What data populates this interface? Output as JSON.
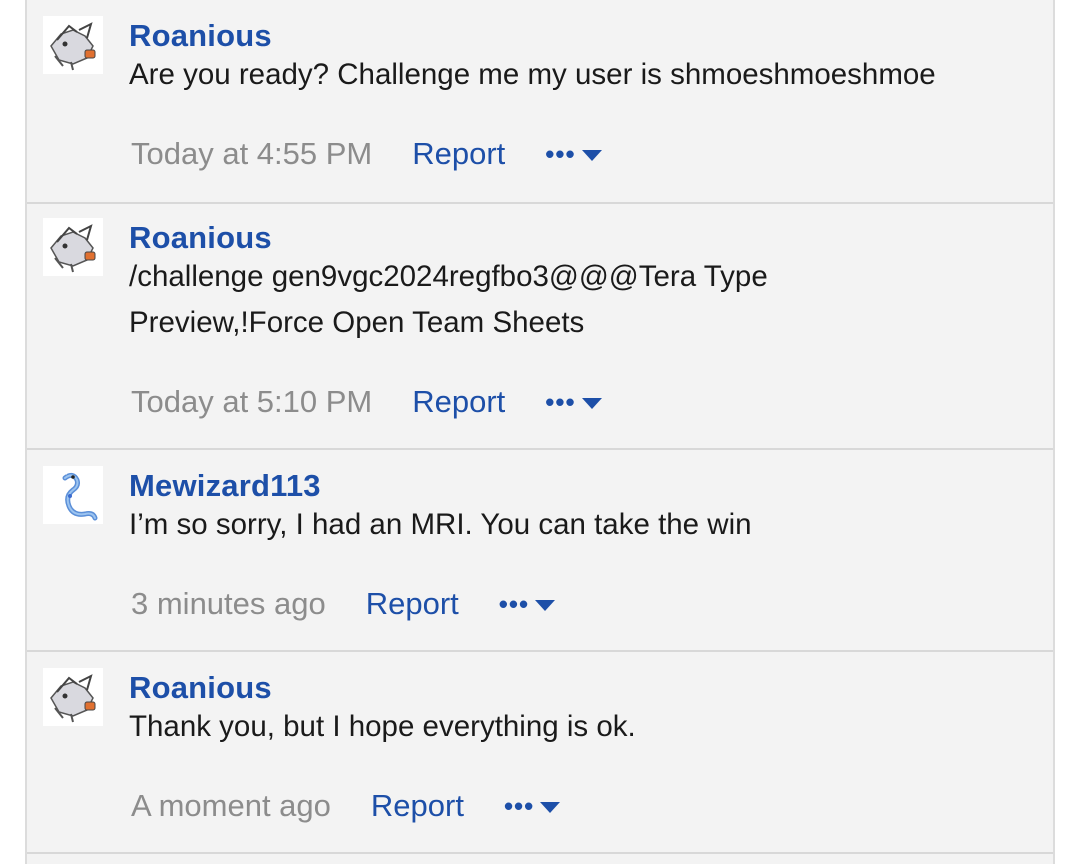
{
  "messages": [
    {
      "author": "Roanious",
      "avatar_icon": "reshiram-sprite-icon",
      "lines": [
        "Are you ready? Challenge me my user is shmoeshmoeshmoe"
      ],
      "time": "Today at 4:55 PM",
      "report_label": "Report",
      "more_label": "•••"
    },
    {
      "author": "Roanious",
      "avatar_icon": "reshiram-sprite-icon",
      "lines": [
        "/challenge gen9vgc2024regfbo3@@@Tera Type",
        "Preview,!Force Open Team Sheets"
      ],
      "time": "Today at 5:10 PM",
      "report_label": "Report",
      "more_label": "•••"
    },
    {
      "author": "Mewizard113",
      "avatar_icon": "dragonair-sprite-icon",
      "lines": [
        "I’m so sorry, I had an MRI. You can take the win"
      ],
      "time": "3 minutes ago",
      "report_label": "Report",
      "more_label": "•••"
    },
    {
      "author": "Roanious",
      "avatar_icon": "reshiram-sprite-icon",
      "lines": [
        "Thank you, but I hope everything is ok."
      ],
      "time": "A moment ago",
      "report_label": "Report",
      "more_label": "•••"
    }
  ],
  "colors": {
    "link": "#1d4fa8",
    "muted": "#8c8c8c",
    "background": "#f3f3f3"
  }
}
